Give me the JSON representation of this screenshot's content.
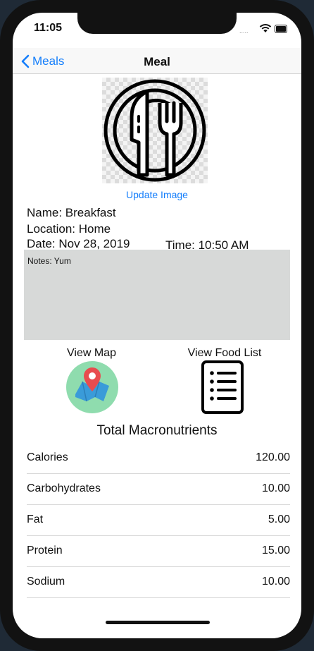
{
  "status_bar": {
    "time": "11:05",
    "signal": "....."
  },
  "navbar": {
    "back_label": "Meals",
    "title": "Meal"
  },
  "image": {
    "icon": "plate-fork-knife-icon",
    "update_label": "Update Image"
  },
  "meal": {
    "name": "Name: Breakfast",
    "location": "Location: Home",
    "date": "Date: Nov 28, 2019",
    "time": "Time: 10:50 AM",
    "notes": "Notes: Yum"
  },
  "actions": {
    "view_map_label": "View Map",
    "view_food_list_label": "View Food List",
    "map_icon": "map-pin-icon",
    "list_icon": "list-document-icon"
  },
  "macros": {
    "title": "Total Macronutrients",
    "rows": [
      {
        "name": "Calories",
        "value": "120.00"
      },
      {
        "name": "Carbohydrates",
        "value": "10.00"
      },
      {
        "name": "Fat",
        "value": "5.00"
      },
      {
        "name": "Protein",
        "value": "15.00"
      },
      {
        "name": "Sodium",
        "value": "10.00"
      }
    ]
  },
  "colors": {
    "accent": "#147efb",
    "notes_bg": "#d7d9d8",
    "map_green": "#8fdcae",
    "map_pin": "#e84c4f"
  }
}
